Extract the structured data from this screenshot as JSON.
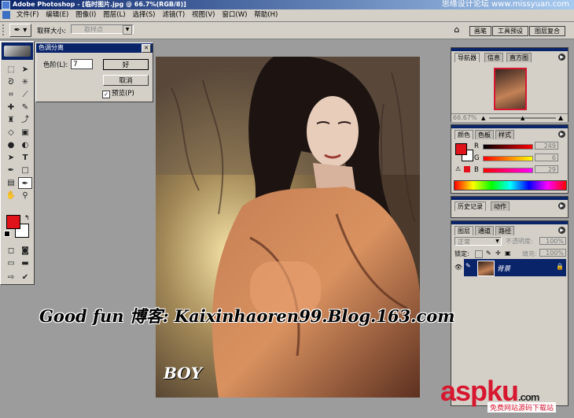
{
  "titlebar": {
    "title": "Adobe Photoshop - [临时图片.jpg @ 66.7%(RGB/8)]",
    "watermark": "思缘设计论坛 www.missyuan.com"
  },
  "menu": [
    "文件(F)",
    "编辑(E)",
    "图像(I)",
    "图层(L)",
    "选择(S)",
    "滤镜(T)",
    "视图(V)",
    "窗口(W)",
    "帮助(H)"
  ],
  "options": {
    "sample_size_label": "取样大小:",
    "sample_size_value": "取样点"
  },
  "panel_tabs": [
    "画笔",
    "工具预设",
    "图层复合"
  ],
  "colors": {
    "foreground": "#e0121a",
    "background": "#ffffff",
    "titlebar": "#0a246a",
    "brand": "#d7172f"
  },
  "dialog": {
    "title": "色调分离",
    "levels_label": "色阶(L):",
    "levels_value": "7",
    "ok": "好",
    "cancel": "取消",
    "preview_label": "预览(P)",
    "preview_checked": true
  },
  "navigator": {
    "tabs": [
      "导航器",
      "信息",
      "直方图"
    ],
    "zoom": "66.67%"
  },
  "color_panel": {
    "tabs": [
      "颜色",
      "色板",
      "样式"
    ],
    "r_label": "R",
    "g_label": "G",
    "b_label": "B",
    "r_value": "249",
    "g_value": "6",
    "b_value": "29"
  },
  "history": {
    "tabs": [
      "历史记录",
      "动作"
    ]
  },
  "layers": {
    "tabs": [
      "图层",
      "通道",
      "路径"
    ],
    "blend_mode": "正常",
    "opacity_label": "不透明度:",
    "opacity_value": "100%",
    "lock_label": "锁定:",
    "fill_label": "填充:",
    "fill_value": "100%",
    "layer_name": "背景"
  },
  "overlay": {
    "text": "Good fun 博客: Kaixinhaoren99.Blog.163.com",
    "boy": "BOY"
  },
  "brand": {
    "name": "aspku",
    "domain": ".com",
    "sub": "免费网站源码下载站"
  }
}
